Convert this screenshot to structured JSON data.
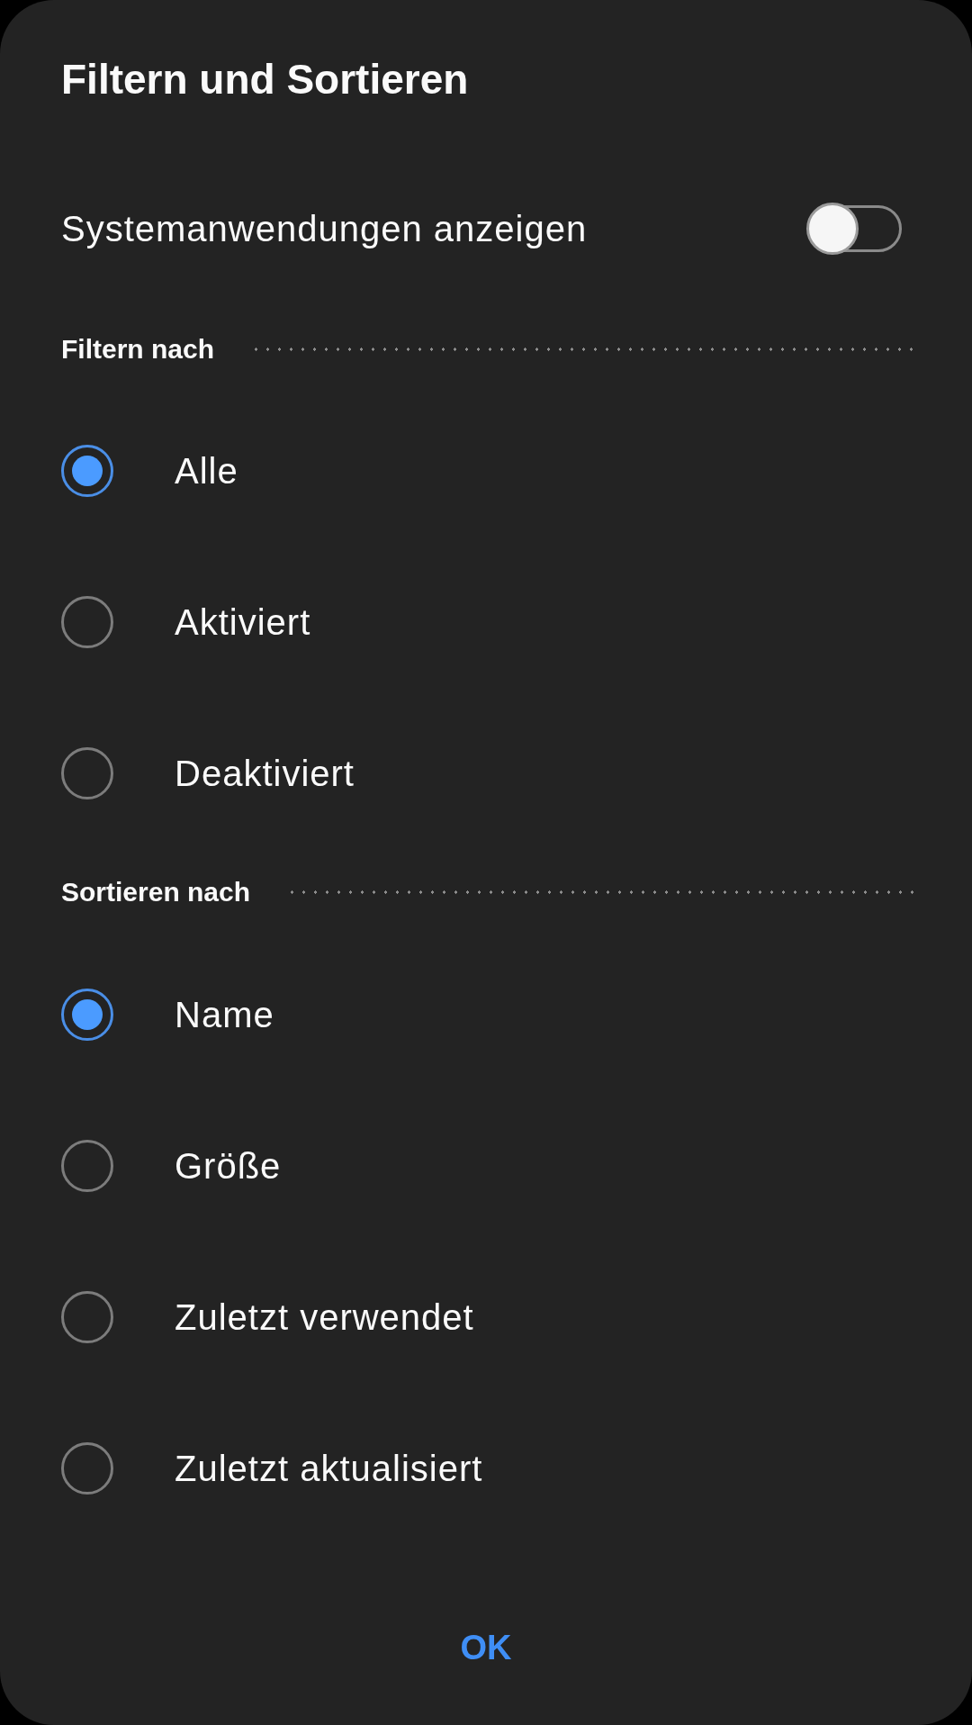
{
  "dialog": {
    "title": "Filtern und Sortieren"
  },
  "toggle": {
    "label": "Systemanwendungen anzeigen",
    "on": false
  },
  "sections": [
    {
      "heading": "Filtern nach",
      "options": [
        {
          "label": "Alle",
          "selected": true
        },
        {
          "label": "Aktiviert",
          "selected": false
        },
        {
          "label": "Deaktiviert",
          "selected": false
        }
      ]
    },
    {
      "heading": "Sortieren nach",
      "options": [
        {
          "label": "Name",
          "selected": true
        },
        {
          "label": "Größe",
          "selected": false
        },
        {
          "label": "Zuletzt verwendet",
          "selected": false
        },
        {
          "label": "Zuletzt aktualisiert",
          "selected": false
        }
      ]
    }
  ],
  "buttons": [
    {
      "label": "OK"
    }
  ]
}
